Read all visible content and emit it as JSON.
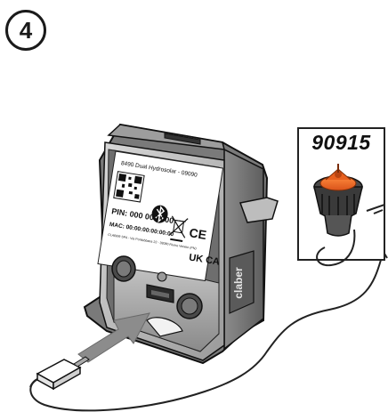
{
  "step": {
    "number": "4"
  },
  "callout": {
    "product_code": "90915"
  },
  "device": {
    "brand": "claber",
    "label": {
      "title": "8490 Dual Hydrosolar - 09090",
      "pin": "PIN: 000 000 000",
      "mac": "MAC: 00:00:00:00:00:00",
      "address": "CLABER SPA - Via Pontebbana 22 - 33080 Fiume Veneto (PN)",
      "ce_mark": "CE",
      "ukca_mark": "UK CA"
    }
  },
  "icons": [
    "bluetooth-icon",
    "weee-bin-icon",
    "qr-code-icon",
    "arrow-right-icon",
    "usb-plug-icon",
    "sensor-probe-icon"
  ]
}
